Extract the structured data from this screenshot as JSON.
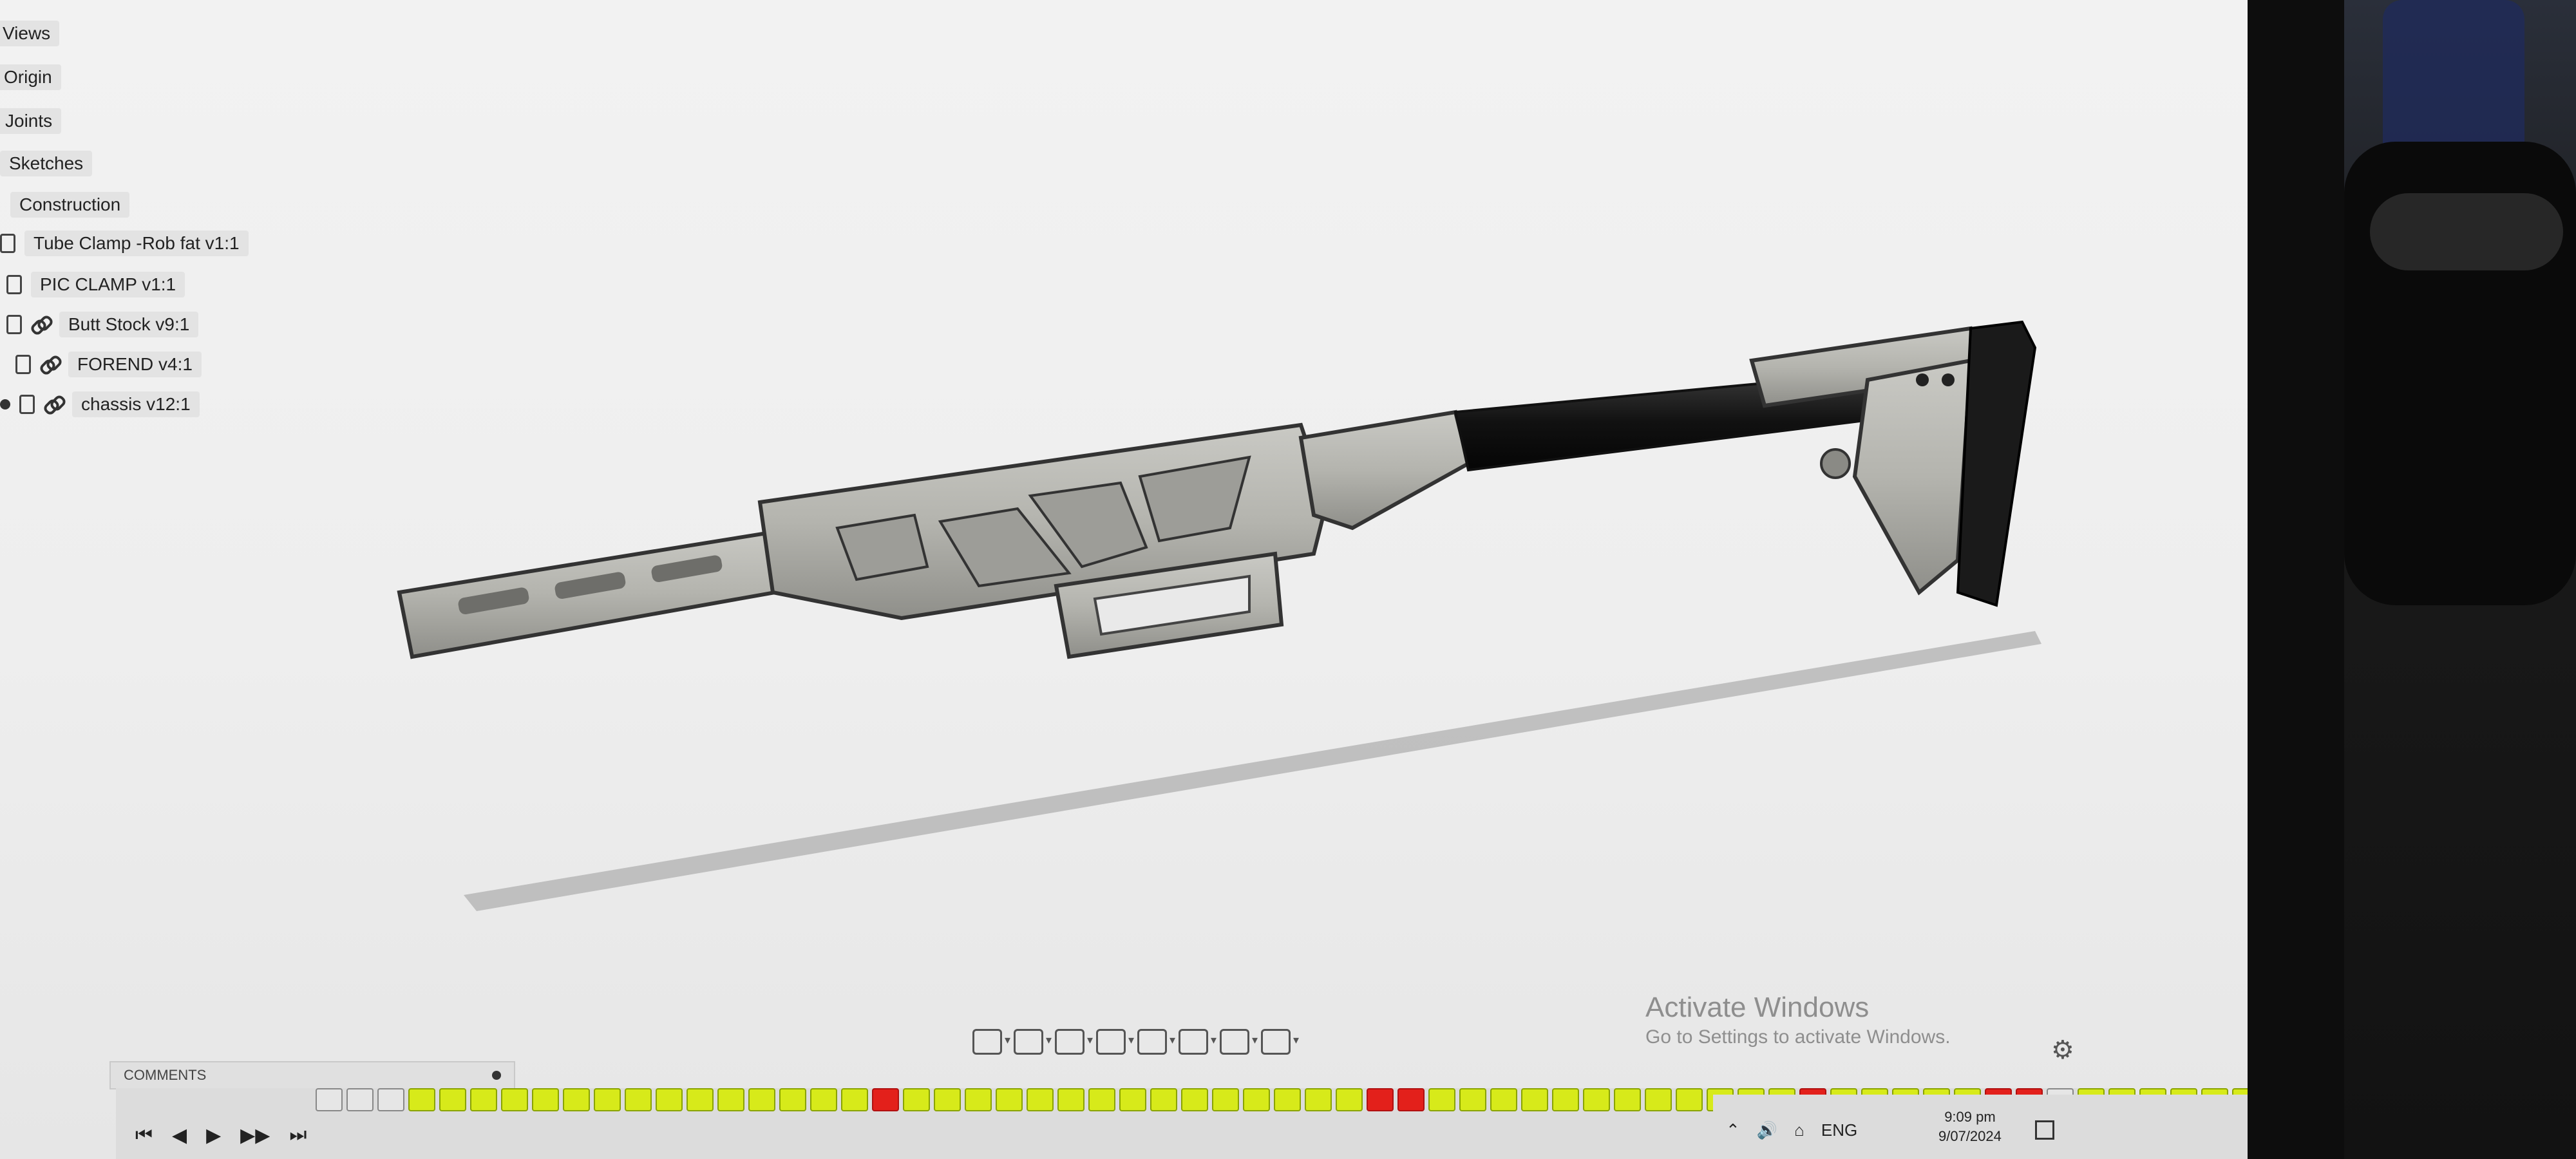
{
  "browser": {
    "items": [
      {
        "label": "Views"
      },
      {
        "label": "Origin"
      },
      {
        "label": "Joints"
      },
      {
        "label": "Sketches"
      },
      {
        "label": "Construction"
      },
      {
        "label": "Tube Clamp -Rob fat v1:1"
      },
      {
        "label": "PIC CLAMP v1:1"
      },
      {
        "label": "Butt Stock v9:1"
      },
      {
        "label": "FOREND v4:1"
      },
      {
        "label": "chassis v12:1"
      }
    ]
  },
  "watermark": {
    "title": "Activate Windows",
    "subtitle": "Go to Settings to activate Windows."
  },
  "comments": {
    "label": "COMMENTS"
  },
  "timeline": {
    "controls": [
      "⏮",
      "◀",
      "▶",
      "▶▶",
      "⏭"
    ]
  },
  "taskbar": {
    "lang": "ENG",
    "time": "9:09 pm",
    "date": "9/07/2024"
  },
  "colors": {
    "feature_yellow": "#d7ea1a",
    "feature_red": "#e3201b",
    "feature_blue": "#3a8de0"
  }
}
